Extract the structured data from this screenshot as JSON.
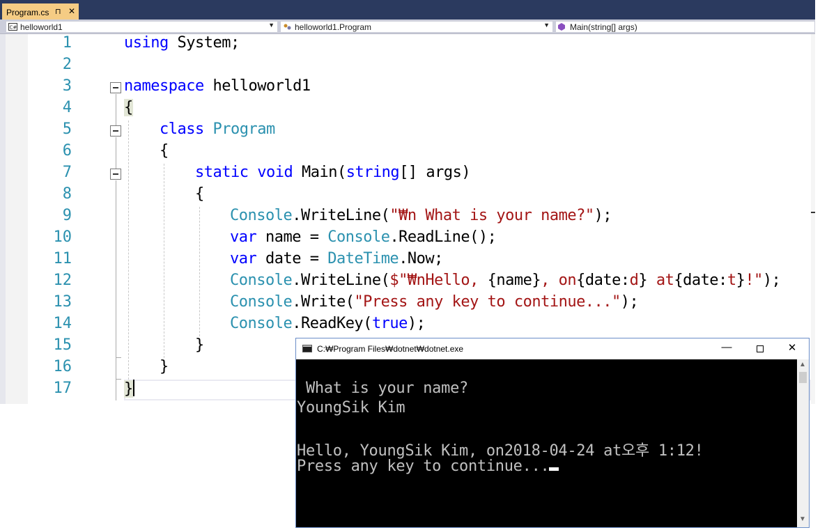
{
  "tab": {
    "title": "Program.cs",
    "pin": "⊓",
    "close": "✕"
  },
  "nav": {
    "project": "helloworld1",
    "class": "helloworld1.Program",
    "member": "Main(string[] args)"
  },
  "code": {
    "line_numbers": [
      "1",
      "2",
      "3",
      "4",
      "5",
      "6",
      "7",
      "8",
      "9",
      "10",
      "11",
      "12",
      "13",
      "14",
      "15",
      "16",
      "17"
    ],
    "l1_kw": "using",
    "l1_rest": " System;",
    "l3_kw": "namespace",
    "l3_rest": " helloworld1",
    "l4": "{",
    "l5_kw": "class",
    "l5_type": "Program",
    "l6": "{",
    "l7_kw1": "static",
    "l7_kw2": "void",
    "l7_name": "Main(",
    "l7_kw3": "string",
    "l7_rest": "[] args)",
    "l8": "{",
    "l9_type": "Console",
    "l9_call": ".WriteLine(",
    "l9_str": "\"₩n What is your name?\"",
    "l9_end": ");",
    "l10_kw": "var",
    "l10_mid": " name = ",
    "l10_type": "Console",
    "l10_end": ".ReadLine();",
    "l11_kw": "var",
    "l11_mid": " date = ",
    "l11_type": "DateTime",
    "l11_end": ".Now;",
    "l12_type": "Console",
    "l12_call": ".WriteLine(",
    "l12_s1": "$\"₩nHello, ",
    "l12_i1": "{name}",
    "l12_s2": ", on",
    "l12_i2a": "{date:",
    "l12_i2b": "d",
    "l12_i2c": "}",
    "l12_s3": " at",
    "l12_i3a": "{date:",
    "l12_i3b": "t",
    "l12_i3c": "}",
    "l12_s4": "!\"",
    "l12_end": ");",
    "l13_type": "Console",
    "l13_call": ".Write(",
    "l13_str": "\"Press any key to continue...\"",
    "l13_end": ");",
    "l14_type": "Console",
    "l14_call": ".ReadKey(",
    "l14_kw": "true",
    "l14_end": ");",
    "l15": "}",
    "l16": "}",
    "l17": "}"
  },
  "console": {
    "title": "C:₩Program Files₩dotnet₩dotnet.exe",
    "min": "—",
    "close": "✕",
    "lines": [
      " What is your name?",
      "YoungSik Kim",
      "",
      "Hello, YoungSik Kim, on2018-04-24 at오후 1:12!",
      "Press any key to continue..."
    ]
  }
}
